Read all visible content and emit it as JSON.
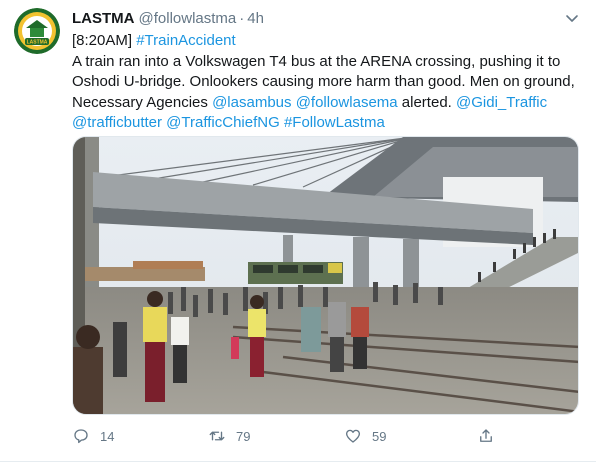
{
  "tweet": {
    "author_name": "LASTMA",
    "author_handle": "@followlastma",
    "separator": "·",
    "time": "4h",
    "avatar_label": "LASTMA",
    "lines": [
      [
        {
          "t": "[8:20AM] ",
          "link": false
        },
        {
          "t": "#TrainAccident",
          "link": true
        }
      ],
      [
        {
          "t": "A train ran into a Volkswagen T4 bus at the ARENA crossing, pushing it to",
          "link": false
        }
      ],
      [
        {
          "t": "Oshodi U-bridge. Onlookers causing more harm than good. Men on ground,",
          "link": false
        }
      ],
      [
        {
          "t": "Necessary Agencies ",
          "link": false
        },
        {
          "t": "@lasambus",
          "link": true
        },
        {
          "t": " ",
          "link": false
        },
        {
          "t": "@followlasema",
          "link": true
        },
        {
          "t": " alerted. ",
          "link": false
        },
        {
          "t": "@Gidi_Traffic",
          "link": true
        }
      ],
      [
        {
          "t": "@trafficbutter",
          "link": true
        },
        {
          "t": " ",
          "link": false
        },
        {
          "t": "@TrafficChiefNG",
          "link": true
        },
        {
          "t": " ",
          "link": false
        },
        {
          "t": "#FollowLastma",
          "link": true
        }
      ]
    ],
    "actions": {
      "reply_count": "14",
      "retweet_count": "79",
      "like_count": "59"
    }
  },
  "colors": {
    "link": "#1b95e0",
    "muted": "#657786",
    "text": "#14171a"
  },
  "icons": [
    "chevron-down-icon",
    "reply-icon",
    "retweet-icon",
    "like-icon",
    "share-icon"
  ]
}
